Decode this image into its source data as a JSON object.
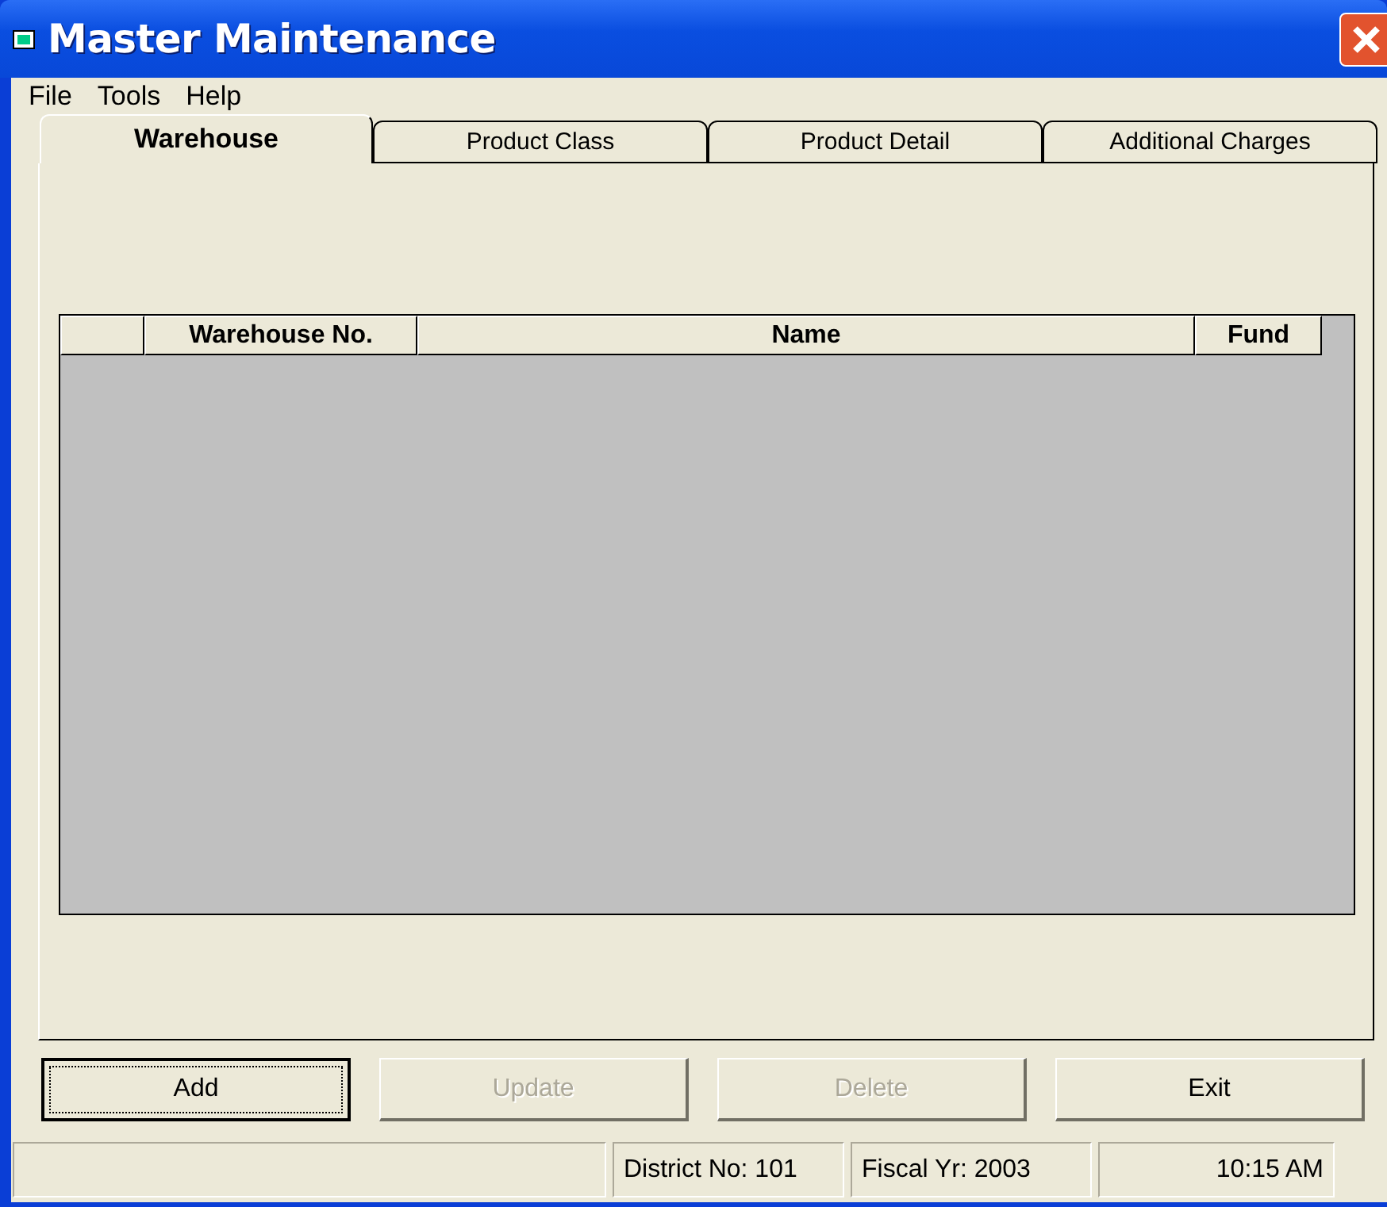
{
  "window": {
    "title": "Master Maintenance"
  },
  "menu": [
    "File",
    "Tools",
    "Help"
  ],
  "tabs": [
    {
      "label": "Warehouse",
      "selected": true
    },
    {
      "label": "Product Class",
      "selected": false
    },
    {
      "label": "Product Detail",
      "selected": false
    },
    {
      "label": "Additional Charges",
      "selected": false
    }
  ],
  "table": {
    "columns": [
      "",
      "Warehouse No.",
      "Name",
      "Fund"
    ]
  },
  "buttons": [
    {
      "label": "Add",
      "disabled": false,
      "focused": true
    },
    {
      "label": "Update",
      "disabled": true,
      "focused": false
    },
    {
      "label": "Delete",
      "disabled": true,
      "focused": false
    },
    {
      "label": "Exit",
      "disabled": false,
      "focused": false
    }
  ],
  "status_bar": [
    "District No: 101",
    "Fiscal Yr: 2003",
    "10:15 AM"
  ]
}
